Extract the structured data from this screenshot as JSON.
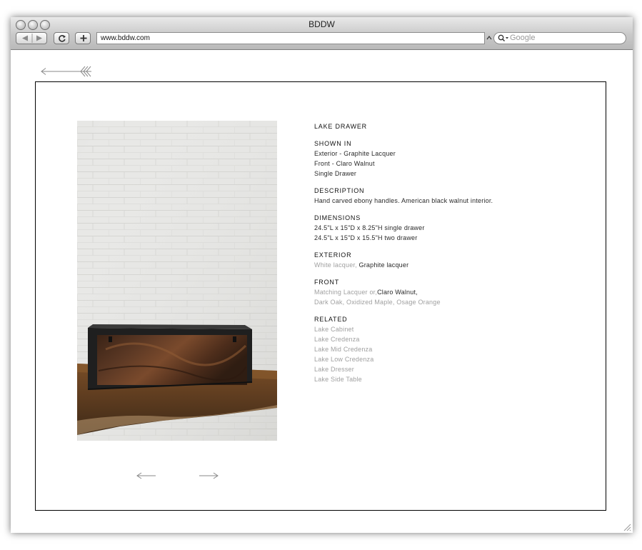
{
  "browser": {
    "title": "BDDW",
    "url": "www.bddw.com",
    "search_placeholder": "Google"
  },
  "product": {
    "name": "LAKE DRAWER",
    "shown_in": {
      "heading": "SHOWN IN",
      "lines": [
        "Exterior - Graphite Lacquer",
        "Front - Claro Walnut",
        "Single Drawer"
      ]
    },
    "description": {
      "heading": "DESCRIPTION",
      "text": "Hand carved ebony handles. American black walnut interior."
    },
    "dimensions": {
      "heading": "DIMENSIONS",
      "lines": [
        "24.5\"L x 15\"D x 8.25\"H single drawer",
        "24.5\"L x 15\"D x 15.5\"H two drawer"
      ]
    },
    "exterior": {
      "heading": "EXTERIOR",
      "option_white": "White lacquer,",
      "option_graphite": "Graphite lacquer"
    },
    "front": {
      "heading": "FRONT",
      "option_matching": "Matching Lacquer or,",
      "option_claro": "Claro Walnut,",
      "option_others": "Dark Oak, Oxidized Maple, Osage Orange"
    },
    "related": {
      "heading": "RELATED",
      "items": [
        "Lake Cabinet",
        "Lake Credenza",
        "Lake Mid Credenza",
        "Lake Low Credenza",
        "Lake Dresser",
        "Lake Side Table"
      ]
    }
  },
  "colors": {
    "heading_text": "#111111",
    "link_grey": "#a0a0a0",
    "frame_border": "#000000"
  },
  "icons": {
    "back": "arrow-left-feathered-icon",
    "prev": "arrow-left-icon",
    "next": "arrow-right-icon"
  }
}
